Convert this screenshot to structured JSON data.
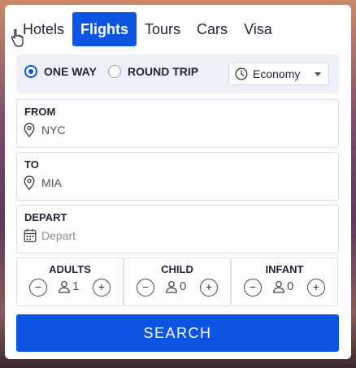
{
  "tabs": [
    "Hotels",
    "Flights",
    "Tours",
    "Cars",
    "Visa"
  ],
  "trip_type": {
    "one_way": "ONE WAY",
    "round_trip": "ROUND TRIP",
    "selected": "ONE WAY"
  },
  "cabin_class": {
    "value": "Economy"
  },
  "from": {
    "label": "FROM",
    "value": "NYC"
  },
  "to": {
    "label": "TO",
    "value": "MIA"
  },
  "depart": {
    "label": "DEPART",
    "placeholder": "Depart"
  },
  "passengers": {
    "adults": {
      "label": "ADULTS",
      "count": "1"
    },
    "child": {
      "label": "CHILD",
      "count": "0"
    },
    "infant": {
      "label": "INFANT",
      "count": "0"
    },
    "minus": "−",
    "plus": "+"
  },
  "search_label": "SEARCH",
  "colors": {
    "accent": "#0c55e3"
  }
}
